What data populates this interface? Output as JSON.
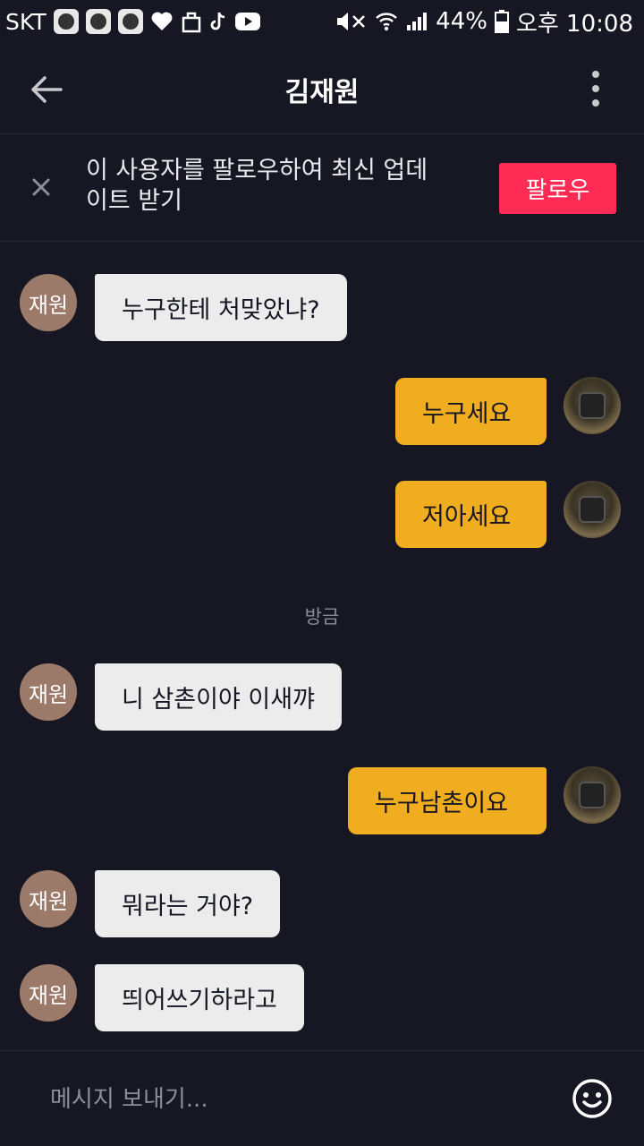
{
  "status_bar": {
    "carrier": "SKT",
    "battery": "44%",
    "time": "오후 10:08"
  },
  "header": {
    "title": "김재원"
  },
  "banner": {
    "text": "이 사용자를 팔로우하여 최신 업데이트 받기",
    "follow_label": "팔로우"
  },
  "messages": [
    {
      "from": "other",
      "avatar_label": "재원",
      "text": "누구한테 처맞았냐?"
    },
    {
      "from": "me",
      "text": "누구세요"
    },
    {
      "from": "me",
      "text": "저아세요"
    },
    {
      "from": "other",
      "avatar_label": "재원",
      "text": "니 삼촌이야 이새꺄"
    },
    {
      "from": "me",
      "text": "누구남촌이요"
    },
    {
      "from": "other",
      "avatar_label": "재원",
      "text": "뭐라는 거야?"
    },
    {
      "from": "other",
      "avatar_label": "재원",
      "text": "띄어쓰기하라고"
    }
  ],
  "timestamp": "방금",
  "input": {
    "placeholder": "메시지 보내기..."
  },
  "colors": {
    "background": "#161723",
    "incoming_bubble": "#ececec",
    "outgoing_bubble": "#f0ad1f",
    "follow_button": "#fe2c55",
    "other_avatar": "#9c7a6a"
  }
}
